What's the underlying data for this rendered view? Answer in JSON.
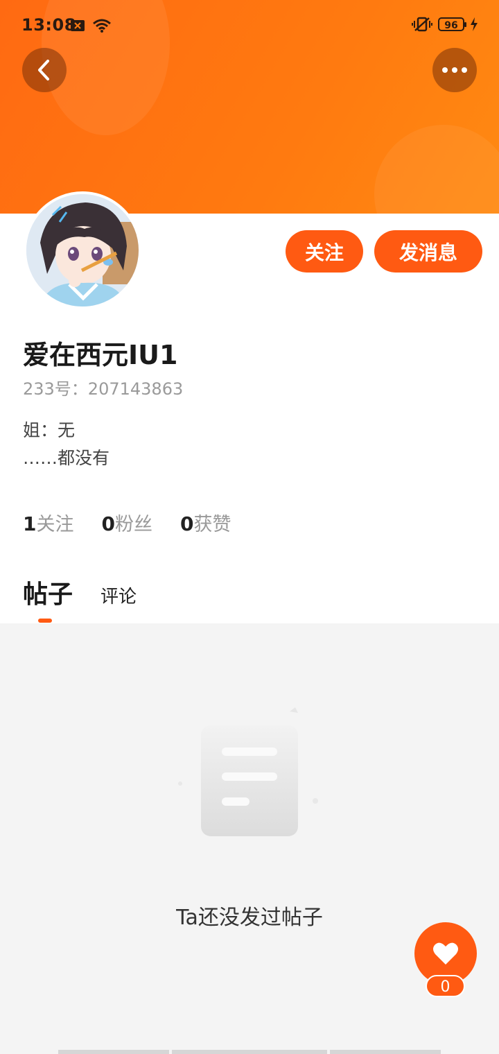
{
  "status_bar": {
    "time": "13:08",
    "battery": "96"
  },
  "header": {
    "back_icon": "chevron-left-icon",
    "more_icon": "more-horizontal-icon"
  },
  "profile": {
    "follow_label": "关注",
    "message_label": "发消息",
    "username": "爱在西元IU1",
    "uid_text": "233号：207143863",
    "bio_line1": "姐：无",
    "bio_line2": "……都没有",
    "stats": {
      "following_count": "1",
      "following_label": "关注",
      "fans_count": "0",
      "fans_label": "粉丝",
      "likes_count": "0",
      "likes_label": "获赞"
    }
  },
  "tabs": {
    "posts_label": "帖子",
    "comments_label": "评论"
  },
  "empty_state": {
    "text": "Ta还没发过帖子"
  },
  "like_fab": {
    "count": "0"
  },
  "colors": {
    "accent": "#ff5a12",
    "header": "#ff7010"
  }
}
